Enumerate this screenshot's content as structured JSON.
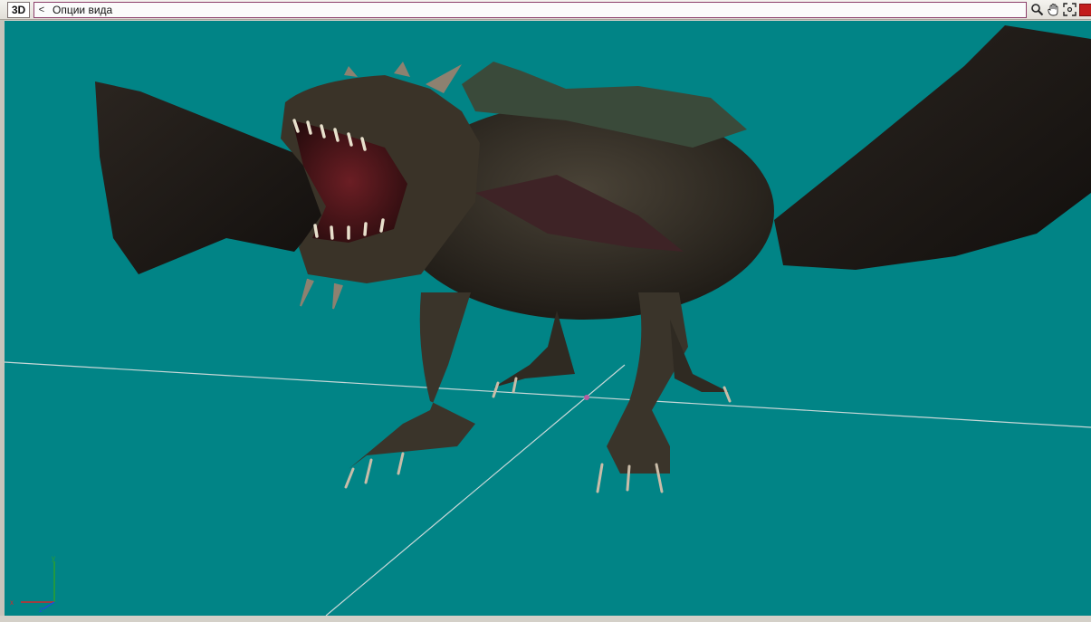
{
  "toolbar": {
    "view_mode": "3D",
    "back_label": "<",
    "options_label": "Опции вида",
    "icons": [
      "zoom-icon",
      "pan-hand-icon",
      "fit-view-icon",
      "close-red-icon"
    ]
  },
  "viewport": {
    "background_color": "#018486",
    "model": "dragon",
    "axes": {
      "x": "x",
      "y": "y",
      "z": "z"
    }
  }
}
